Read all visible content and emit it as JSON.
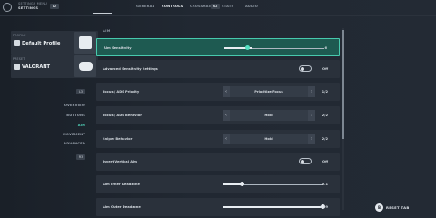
{
  "header": {
    "back_icon": "back-arrow-icon",
    "breadcrumb_top": "SETTINGS MENU",
    "breadcrumb_title": "SETTINGS",
    "prev_key": "L2",
    "next_key": "R2",
    "tabs": [
      "GENERAL",
      "CONTROLS",
      "CROSSHAIR",
      "STATS",
      "AUDIO"
    ],
    "active_tab": "CONTROLS"
  },
  "profiles": [
    {
      "label": "PROFILE",
      "value": "Default Profile",
      "icon": "agent-emblem-icon"
    },
    {
      "label": "PRESET",
      "value": "VALORANT",
      "icon": "gamepad-icon"
    }
  ],
  "side_nav": {
    "up_key": "L3",
    "down_key": "R3",
    "items": [
      "OVERVIEW",
      "BUTTONS",
      "AIM",
      "MOVEMENT",
      "ADVANCED"
    ],
    "active": "AIM"
  },
  "aim": {
    "section_title": "AIM",
    "rows": [
      {
        "label": "Aim Sensitivity",
        "type": "slider",
        "value": "6",
        "fill": 0.27
      },
      {
        "label": "Advanced Sensitivity Settings",
        "type": "toggle",
        "value": "Off"
      },
      {
        "label": "Focus / ADS Priority",
        "type": "selector",
        "option": "Prioritize Focus",
        "value": "1/2"
      },
      {
        "label": "Focus / ADS Behavior",
        "type": "selector",
        "option": "Hold",
        "value": "2/2"
      },
      {
        "label": "Sniper Behavior",
        "type": "selector",
        "option": "Hold",
        "value": "2/2"
      },
      {
        "label": "Invert Vertical Aim",
        "type": "toggle",
        "value": "Off"
      },
      {
        "label": "Aim Inner Deadzone",
        "type": "slider",
        "value": "0.1",
        "fill": 0.18
      },
      {
        "label": "Aim Outer Deadzone",
        "type": "slider",
        "value": "0.99",
        "fill": 0.99
      }
    ]
  },
  "footer": {
    "reset_key": "B",
    "reset_label": "RESET TAB"
  },
  "colors": {
    "accent": "#47c9ad",
    "highlight_bg": "#1e5a51",
    "row_bg": "#2a313b"
  }
}
